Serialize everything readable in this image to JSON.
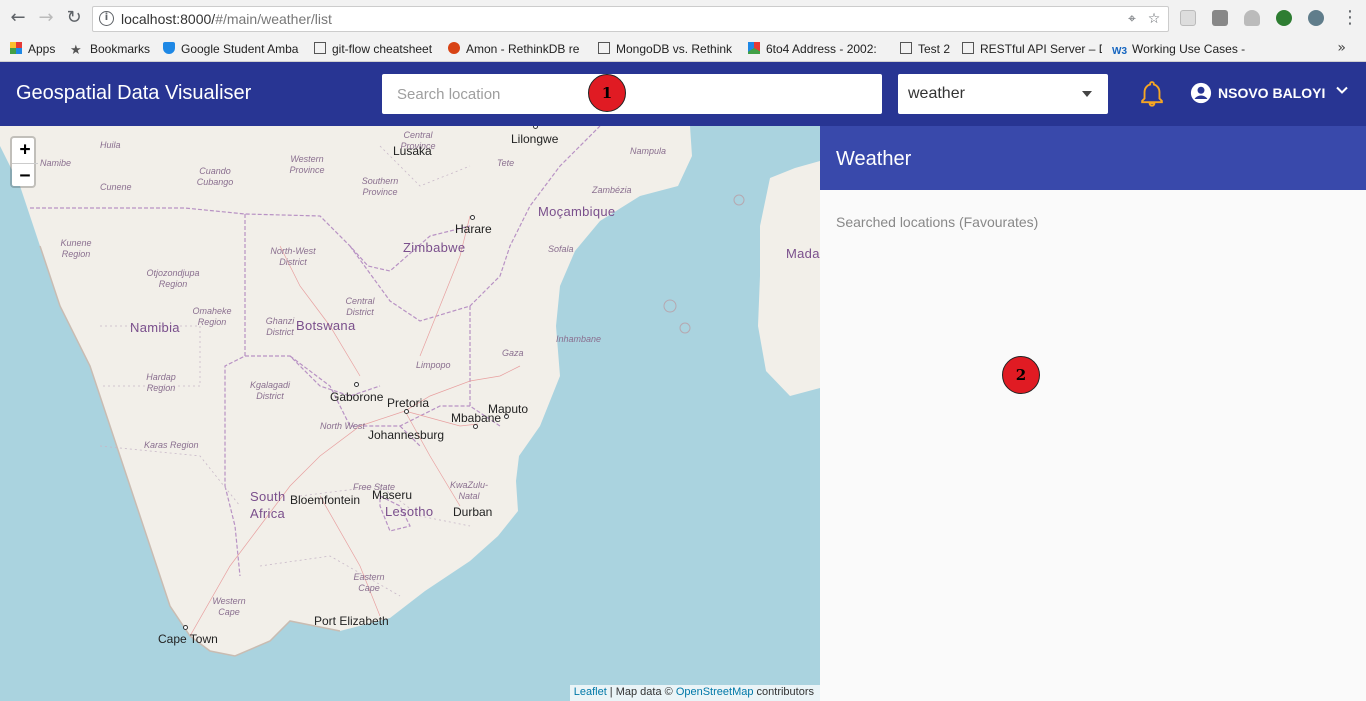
{
  "browser": {
    "url_host": "localhost:8000/",
    "url_path": "#/main/weather/list",
    "bookmarks": [
      {
        "label": "Apps",
        "icon": "apps-grid-icon"
      },
      {
        "label": "Bookmarks",
        "icon": "star-icon"
      },
      {
        "label": "Google Student Amba",
        "icon": "shield-icon"
      },
      {
        "label": "git-flow cheatsheet",
        "icon": "page-icon"
      },
      {
        "label": "Amon - RethinkDB re",
        "icon": "amon-icon"
      },
      {
        "label": "MongoDB vs. Rethink",
        "icon": "page-icon"
      },
      {
        "label": "6to4 Address - 2002:",
        "icon": "puzzle-icon"
      },
      {
        "label": "Test 2",
        "icon": "page-icon"
      },
      {
        "label": "RESTful API Server – D",
        "icon": "page-icon"
      },
      {
        "label": "Working Use Cases - S",
        "icon": "w3-icon"
      }
    ],
    "more_symbol": "»"
  },
  "appbar": {
    "title": "Geospatial Data Visualiser",
    "search_placeholder": "Search location",
    "layer_select_value": "weather",
    "user_name": "NSOVO BALOYI",
    "bell_color": "#f6a623",
    "color": "#283593"
  },
  "map": {
    "zoom_in": "+",
    "zoom_out": "−",
    "attribution": {
      "leaflet": "Leaflet",
      "separator": " | Map data © ",
      "osm": "OpenStreetMap",
      "suffix": " contributors"
    },
    "countries": [
      "Namibia",
      "Botswana",
      "Zimbabwe",
      "Moçambique",
      "South Africa",
      "Lesotho",
      "Mada"
    ],
    "cities": [
      "Lusaka",
      "Lilongwe",
      "Harare",
      "Gaborone",
      "Pretoria",
      "Johannesburg",
      "Mbabane",
      "Maputo",
      "Maseru",
      "Bloemfontein",
      "Durban",
      "Port Elizabeth",
      "Cape Town"
    ],
    "regions": [
      "Huila",
      "Namibe",
      "Cunene",
      "Cuando Cubango",
      "Western Province",
      "Southern Province",
      "Central Province",
      "Tete",
      "Nampula",
      "Zambézia",
      "Kunene Region",
      "Otjozondjupa Region",
      "Omaheke Region",
      "North-West District",
      "Ghanzi District",
      "Central District",
      "Sofala",
      "Inhambane",
      "Gaza",
      "Limpopo",
      "Hardap Region",
      "Kgalagadi District",
      "North West",
      "Karas Region",
      "Free State",
      "KwaZulu-Natal",
      "Eastern Cape",
      "Western Cape"
    ]
  },
  "panel": {
    "title": "Weather",
    "subtitle": "Searched locations (Favourates)",
    "header_color": "#3949ab"
  },
  "annotations": [
    "1",
    "2"
  ]
}
